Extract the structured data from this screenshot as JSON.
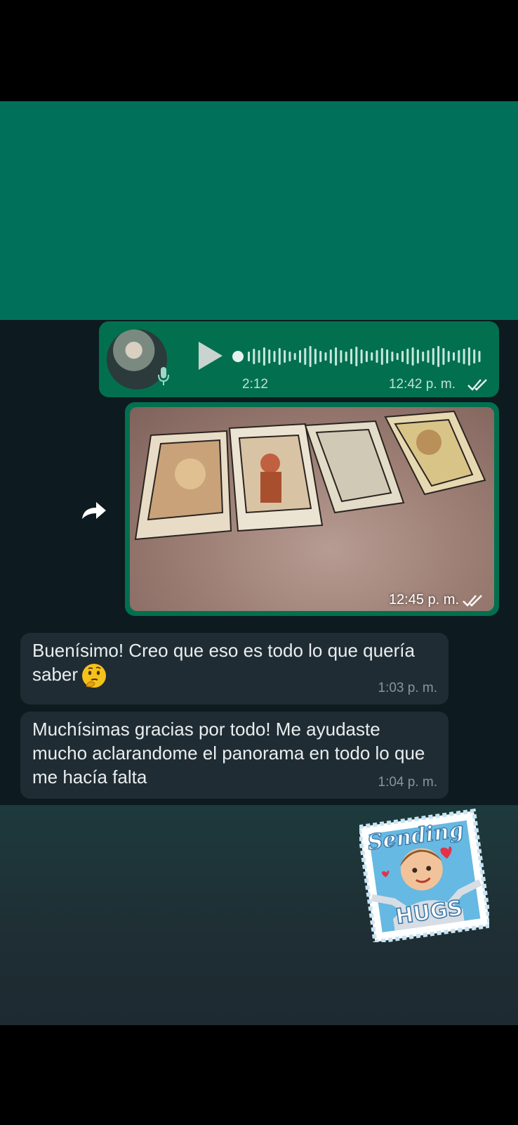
{
  "audio_message": {
    "duration": "2:12",
    "time": "12:42 p. m.",
    "status": "read",
    "icons": [
      "play-icon",
      "mic-icon",
      "double-check-icon"
    ]
  },
  "image_message": {
    "time": "12:45 p. m.",
    "status": "read",
    "icons": [
      "forward-icon",
      "double-check-icon"
    ]
  },
  "messages": [
    {
      "text": "Buenísimo! Creo que eso es todo lo que quería saber",
      "emoji": "thinking-face",
      "time": "1:03 p. m."
    },
    {
      "text": "Muchísimas gracias por todo! Me ayudaste mucho aclarandome el panorama en todo lo que me hacía falta",
      "time": "1:04 p. m."
    }
  ],
  "sticker": {
    "top_text": "Sending",
    "bottom_text": "HUGS"
  },
  "colors": {
    "header_green": "#01705a",
    "sent_bubble": "#02704f",
    "received_bubble": "#1f2c33",
    "chat_background": "#0d1a1f",
    "tick_color": "#e6f2ee"
  }
}
